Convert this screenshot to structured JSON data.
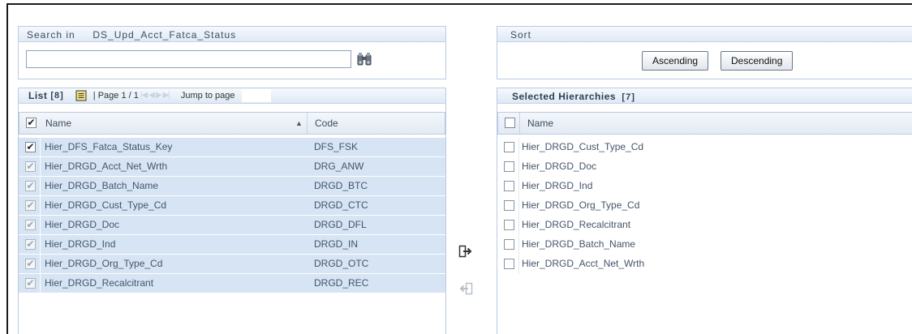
{
  "search": {
    "label": "Search in",
    "dataset": "DS_Upd_Acct_Fatca_Status",
    "value": "",
    "button_icon": "binoculars-icon"
  },
  "list": {
    "title": "List",
    "count": "[8]",
    "page_text": "| Page 1 / 1",
    "jump_label": "Jump to page",
    "columns": {
      "name": "Name",
      "code": "Code"
    },
    "rows": [
      {
        "name": "Hier_DFS_Fatca_Status_Key",
        "code": "DFS_FSK",
        "checked": true,
        "enabled": true
      },
      {
        "name": "Hier_DRGD_Acct_Net_Wrth",
        "code": "DRG_ANW",
        "checked": true,
        "enabled": false
      },
      {
        "name": "Hier_DRGD_Batch_Name",
        "code": "DRGD_BTC",
        "checked": true,
        "enabled": false
      },
      {
        "name": "Hier_DRGD_Cust_Type_Cd",
        "code": "DRGD_CTC",
        "checked": true,
        "enabled": false
      },
      {
        "name": "Hier_DRGD_Doc",
        "code": "DRGD_DFL",
        "checked": true,
        "enabled": false
      },
      {
        "name": "Hier_DRGD_Ind",
        "code": "DRGD_IN",
        "checked": true,
        "enabled": false
      },
      {
        "name": "Hier_DRGD_Org_Type_Cd",
        "code": "DRGD_OTC",
        "checked": true,
        "enabled": false
      },
      {
        "name": "Hier_DRGD_Recalcitrant",
        "code": "DRGD_REC",
        "checked": true,
        "enabled": false
      }
    ]
  },
  "sort": {
    "title": "Sort",
    "ascending_label": "Ascending",
    "descending_label": "Descending"
  },
  "selected": {
    "title": "Selected Hierarchies",
    "count": "[7]",
    "column_name": "Name",
    "rows": [
      {
        "name": "Hier_DRGD_Cust_Type_Cd"
      },
      {
        "name": "Hier_DRGD_Doc"
      },
      {
        "name": "Hier_DRGD_Ind"
      },
      {
        "name": "Hier_DRGD_Org_Type_Cd"
      },
      {
        "name": "Hier_DRGD_Recalcitrant"
      },
      {
        "name": "Hier_DRGD_Batch_Name"
      },
      {
        "name": "Hier_DRGD_Acct_Net_Wrth"
      }
    ]
  }
}
